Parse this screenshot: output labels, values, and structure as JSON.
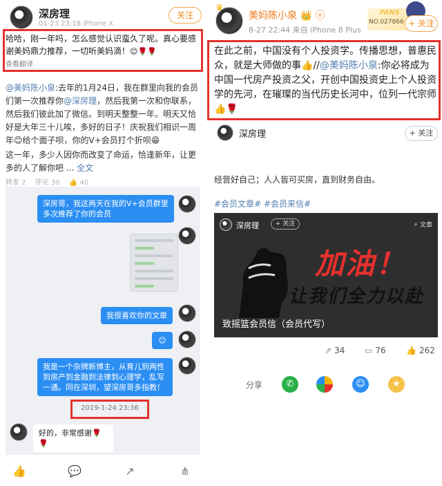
{
  "left": {
    "user_name": "深房理",
    "meta": "01-23 23:18 iPhone X",
    "follow_label": "关注",
    "comment_text": "哈哈，刚一年吗，怎么感觉认识蛮久了呢。真心要感谢美妈鼎力推荐，一切听美妈滴！",
    "comment_emojis": "😊🌹🌹",
    "translate_label": "查看翻译",
    "post_mention": "@美妈陈小泉",
    "post_body_a": ":去年的1月24日，我在群里向我的会员们第一次推荐你",
    "post_mention2": "@深房理",
    "post_body_b": "，然后我第一次和你联系，然后我们彼此加了微信。到明天整整一年。明天又恰好是大年三十儿唉，多好的日子！庆祝我们相识一周年",
    "post_emoji1": "😊",
    "post_body_c": "给个面子呗，你的V+会员打个折呗",
    "post_emoji2": "😁",
    "post_para2": "这一年，多少人因你而改变了命运，恰逢新年，让更多的人了解你吧 ...",
    "full_text_label": "全文",
    "stats": {
      "reposts": "转发 2",
      "comments": "评论 30",
      "likes": "40"
    },
    "chat": {
      "msg1": "深房哥，我这两天在我的V+会员群里多次推荐了你的会员",
      "msg2": "我很喜欢你的文章",
      "msg3": "😊",
      "msg4": "我是一个杂牌新博主，从育儿到两性到房产到金融到法律到心理学，乱写一通。同在深圳，望深房哥多指教！",
      "time": "2019-1-24 23:36",
      "reply": "好的，非常感谢🌹🌹"
    },
    "bottom_icons": [
      "like-icon",
      "comment-icon",
      "share-out-icon",
      "forward-icon"
    ]
  },
  "right": {
    "user_name": "美妈陈小泉",
    "user_badges": "👑 ⓥ",
    "meta": "8-27 22:44 来自 iPhone 8 Plus",
    "fans_label": "FANS",
    "fans_no": "NO.027866",
    "follow_label": "+ 关注",
    "post_text": "在此之前，中国没有个人投资学。传播思想，普惠民众，就是大师做的事",
    "post_emoji1": "👍",
    "post_sep": "//",
    "post_mention": "@美妈陈小泉",
    "post_text2": ":你必将成为中国一代房产投资之父，开创中国投资史上个人投资学的先河，在璀璨的当代历史长河中，位列一代宗师",
    "post_emoji2": "👍🌹",
    "user2_name": "深房理",
    "user2_follow": "+ 关注",
    "body_text": "经营好自己；人人皆可买房，直到财务自由。",
    "tags": "#会员文章# #会员来信#",
    "card": {
      "user": "深房理",
      "follow": "+ 关注",
      "article": "⚡ 文章",
      "slogan1": "加油！",
      "slogan2": "让我们全力以赴",
      "caption": "致摇篮会员信（会员代写）"
    },
    "stats": {
      "reposts": "34",
      "comments": "76",
      "likes": "262"
    },
    "share_label": "分享",
    "share_icons": [
      "wechat-icon",
      "moments-icon",
      "qq-icon",
      "qzone-icon"
    ]
  }
}
